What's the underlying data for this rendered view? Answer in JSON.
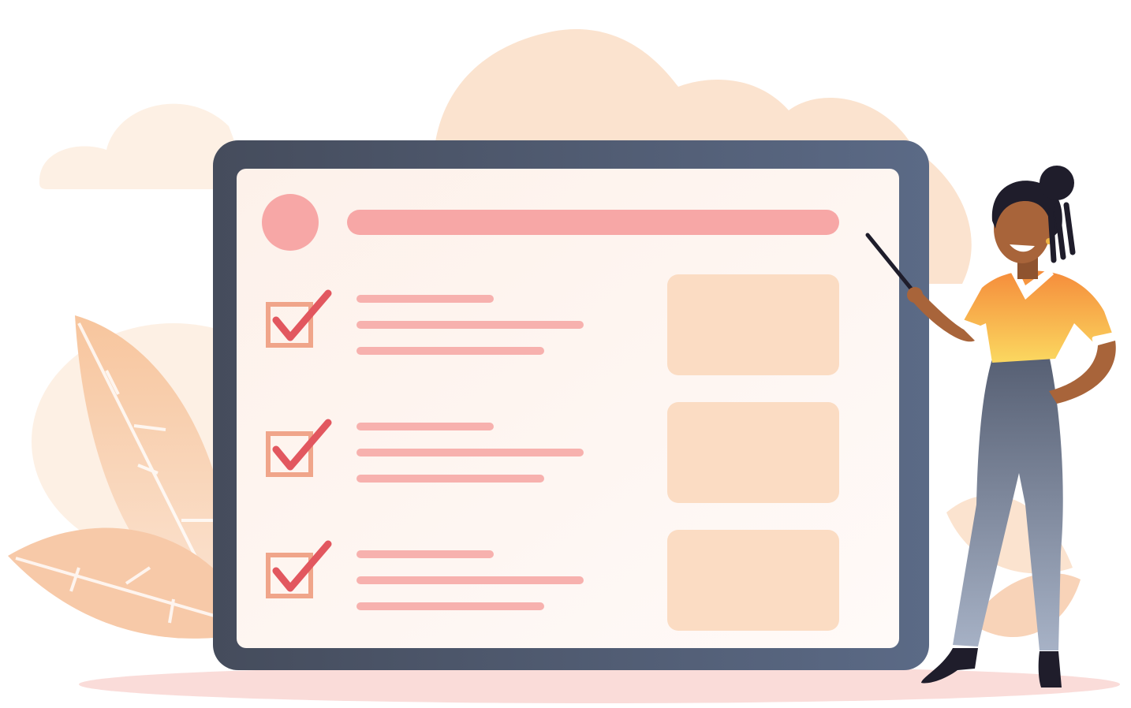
{
  "illustration": {
    "subject": "checklist-presentation",
    "checklist": {
      "items": [
        {
          "checked": true,
          "text_lines": 3
        },
        {
          "checked": true,
          "text_lines": 3
        },
        {
          "checked": true,
          "text_lines": 3
        }
      ],
      "cards": 3
    },
    "colors": {
      "background": "#ffffff",
      "cloud": "#fbe3cf",
      "cloud_light": "#fdf0e4",
      "leaf": "#f6c39a",
      "frame": "#4a5468",
      "frame_light": "#6d7a92",
      "screen": "#fdf4ef",
      "accent_pink": "#f7a7a6",
      "check_red": "#e2575f",
      "checkbox_border": "#f0a58a",
      "card": "#fbdcc3",
      "shirt_orange": "#f58c3b",
      "shirt_yellow": "#fbd25a",
      "pants": "#6f7a8f",
      "skin": "#a8643a",
      "hair": "#1f1d2b",
      "shadow": "#f9d3d0"
    }
  }
}
